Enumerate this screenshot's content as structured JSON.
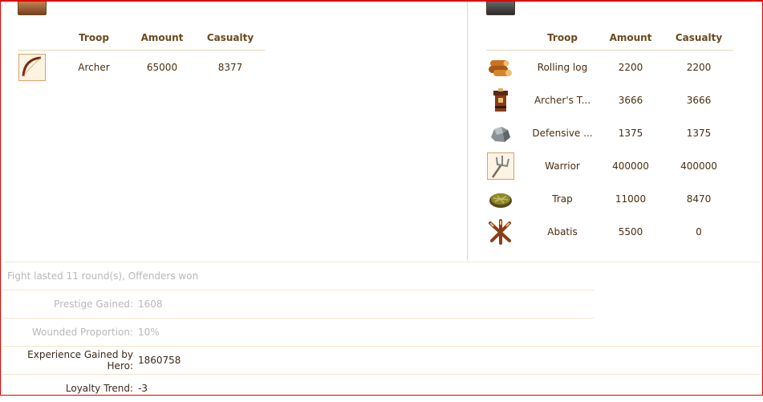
{
  "left_panel": {
    "headers": [
      "Troop",
      "Amount",
      "Casualty"
    ],
    "rows": [
      {
        "icon": "bow-icon",
        "troop": "Archer",
        "amount": "65000",
        "casualty": "8377"
      }
    ]
  },
  "right_panel": {
    "headers": [
      "Troop",
      "Amount",
      "Casualty"
    ],
    "rows": [
      {
        "icon": "log-icon",
        "troop": "Rolling log",
        "amount": "2200",
        "casualty": "2200"
      },
      {
        "icon": "tower-icon",
        "troop": "Archer's T...",
        "amount": "3666",
        "casualty": "3666"
      },
      {
        "icon": "rock-icon",
        "troop": "Defensive ...",
        "amount": "1375",
        "casualty": "1375"
      },
      {
        "icon": "pitchfork-icon",
        "troop": "Warrior",
        "amount": "400000",
        "casualty": "400000"
      },
      {
        "icon": "trap-icon",
        "troop": "Trap",
        "amount": "11000",
        "casualty": "8470"
      },
      {
        "icon": "abatis-icon",
        "troop": "Abatis",
        "amount": "5500",
        "casualty": "0"
      }
    ]
  },
  "summary": {
    "result": "Fight lasted 11 round(s), Offenders won",
    "prestige_label": "Prestige Gained:",
    "prestige_value": "1608",
    "wounded_label": "Wounded Proportion:",
    "wounded_value": "10%",
    "experience_label": "Experience Gained by Hero:",
    "experience_value": "1860758",
    "loyalty_label": "Loyalty Trend:",
    "loyalty_value": "-3"
  }
}
